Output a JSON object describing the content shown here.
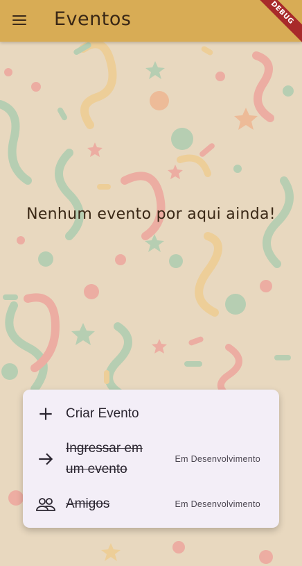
{
  "app": {
    "title": "Eventos",
    "debug_banner": "DEBUG"
  },
  "empty_state": {
    "message": "Nenhum evento por aqui ainda!"
  },
  "menu": {
    "items": [
      {
        "label": "Criar Evento",
        "icon": "plus-icon",
        "status": ""
      },
      {
        "label": "Ingressar em um evento",
        "label_line1": "Ingressar em",
        "label_line2": "um evento",
        "icon": "arrow-right-icon",
        "status": "Em Desenvolvimento"
      },
      {
        "label": "Amigos",
        "icon": "people-icon",
        "status": "Em Desenvolvimento"
      }
    ]
  },
  "colors": {
    "appbar": "#d8ac55",
    "background": "#e8d8bf",
    "menu_card": "#f3eef7",
    "debug_banner": "#a82a2a"
  }
}
